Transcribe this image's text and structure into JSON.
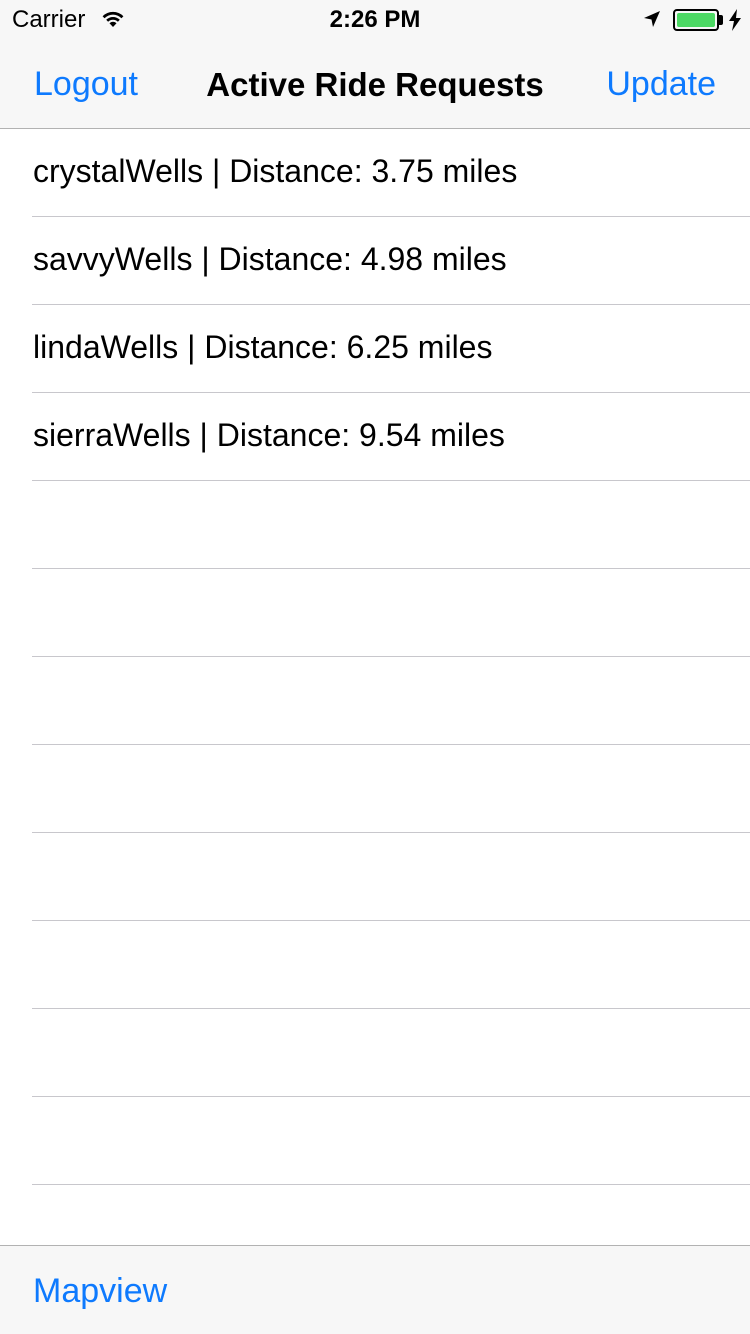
{
  "status_bar": {
    "carrier": "Carrier",
    "time": "2:26 PM",
    "battery_color": "#4cd964"
  },
  "nav_bar": {
    "left_button": "Logout",
    "title": "Active Ride Requests",
    "right_button": "Update",
    "tint_color": "#0e7afe"
  },
  "ride_requests": [
    {
      "label": "crystalWells | Distance: 3.75 miles"
    },
    {
      "label": "savvyWells | Distance: 4.98 miles"
    },
    {
      "label": "lindaWells | Distance: 6.25 miles"
    },
    {
      "label": "sierraWells | Distance: 9.54 miles"
    },
    {
      "label": ""
    },
    {
      "label": ""
    },
    {
      "label": ""
    },
    {
      "label": ""
    },
    {
      "label": ""
    },
    {
      "label": ""
    },
    {
      "label": ""
    },
    {
      "label": ""
    },
    {
      "label": ""
    }
  ],
  "toolbar": {
    "mapview_button": "Mapview"
  }
}
